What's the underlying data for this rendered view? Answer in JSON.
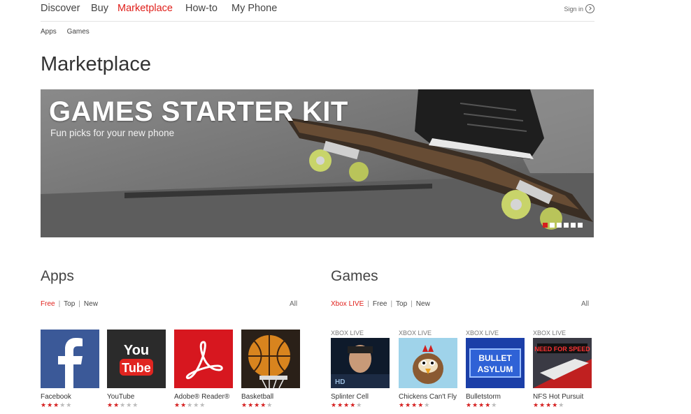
{
  "nav": {
    "items": [
      "Discover",
      "Buy",
      "Marketplace",
      "How-to",
      "My Phone"
    ],
    "active_index": 2,
    "sign_in": "Sign in"
  },
  "subnav": [
    "Apps",
    "Games"
  ],
  "page_title": "Marketplace",
  "hero": {
    "title": "GAMES STARTER KIT",
    "subtitle": "Fun picks for your new phone",
    "slide_count": 6,
    "active_slide": 0
  },
  "apps": {
    "title": "Apps",
    "filters": [
      "Free",
      "Top",
      "New"
    ],
    "active_filter": 0,
    "all_label": "All",
    "tiles": [
      {
        "name": "Facebook",
        "rating": 3,
        "icon": "facebook-icon"
      },
      {
        "name": "YouTube",
        "rating": 2.5,
        "icon": "youtube-icon"
      },
      {
        "name": "Adobe® Reader®",
        "rating": 2.5,
        "icon": "adobe-reader-icon"
      },
      {
        "name": "Basketball",
        "rating": 4,
        "icon": "basketball-icon"
      }
    ]
  },
  "games": {
    "title": "Games",
    "filters": [
      "Xbox LIVE",
      "Free",
      "Top",
      "New"
    ],
    "active_filter": 0,
    "all_label": "All",
    "tiles": [
      {
        "badge": "XBOX LIVE",
        "name": "Splinter Cell",
        "rating": 4,
        "icon": "splinter-cell-icon"
      },
      {
        "badge": "XBOX LIVE",
        "name": "Chickens Can't Fly",
        "rating": 4,
        "icon": "chicken-icon"
      },
      {
        "badge": "XBOX LIVE",
        "name": "Bulletstorm",
        "rating": 4,
        "icon": "bulletstorm-icon"
      },
      {
        "badge": "XBOX LIVE",
        "name": "NFS Hot Pursuit",
        "rating": 4,
        "icon": "nfs-icon"
      }
    ]
  },
  "colors": {
    "accent": "#e0201b",
    "star": "#d51f1f"
  }
}
